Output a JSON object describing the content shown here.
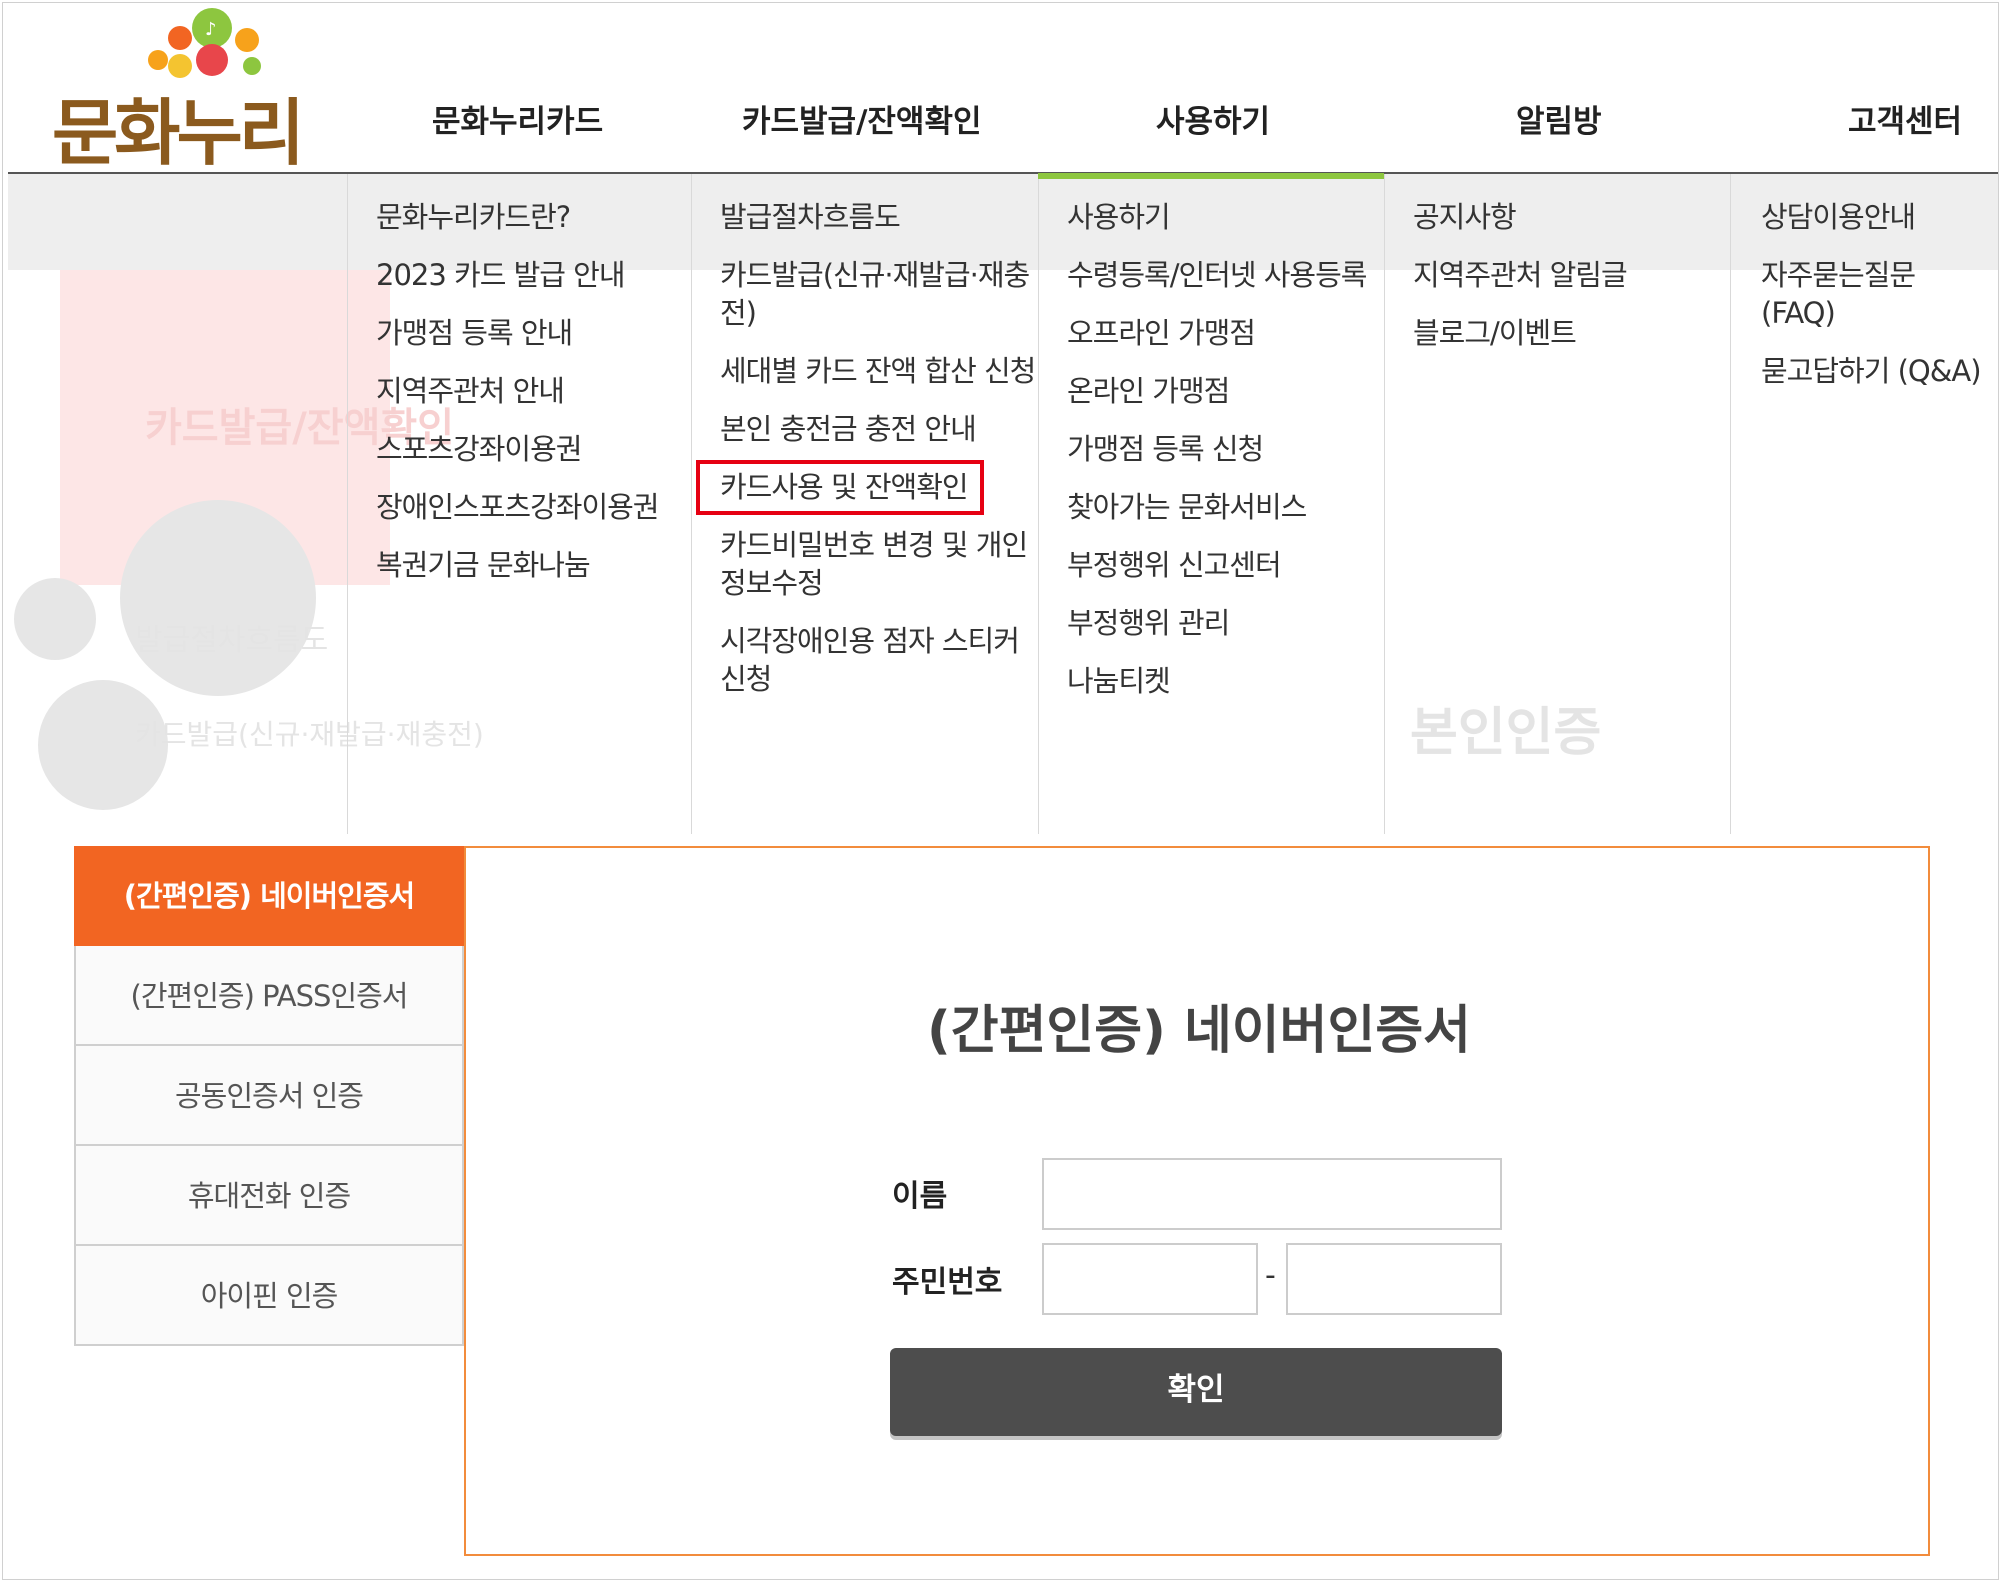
{
  "logo": {
    "text": "문화누리"
  },
  "nav": [
    "문화누리카드",
    "카드발급/잔액확인",
    "사용하기",
    "알림방",
    "고객센터"
  ],
  "menu": [
    [
      "문화누리카드란?",
      "2023 카드 발급 안내",
      "가맹점 등록 안내",
      "지역주관처 안내",
      "스포츠강좌이용권",
      "장애인스포츠강좌이용권",
      "복권기금 문화나눔"
    ],
    [
      "발급절차흐름도",
      "카드발급(신규·재발급·재충전)",
      "세대별 카드 잔액 합산 신청",
      "본인 충전금 충전 안내",
      "카드사용 및 잔액확인",
      "카드비밀번호 변경 및 개인정보수정",
      "시각장애인용 점자 스티커 신청"
    ],
    [
      "사용하기",
      "수령등록/인터넷 사용등록",
      "오프라인 가맹점",
      "온라인 가맹점",
      "가맹점 등록 신청",
      "찾아가는 문화서비스",
      "부정행위 신고센터",
      "부정행위 관리",
      "나눔티켓"
    ],
    [
      "공지사항",
      "지역주관처 알림글",
      "블로그/이벤트"
    ],
    [
      "상담이용안내",
      "자주묻는질문 (FAQ)",
      "묻고답하기 (Q&A)"
    ]
  ],
  "background_page": {
    "title": "카드발급/잔액확인",
    "sub1": "발급절차흐름도",
    "sub2": "카드발급(신규·재발급·재충전)",
    "heading": "본인인증"
  },
  "auth": {
    "tabs": [
      "(간편인증) 네이버인증서",
      "(간편인증) PASS인증서",
      "공동인증서 인증",
      "휴대전화 인증",
      "아이핀 인증"
    ],
    "active_tab": 0,
    "title": "(간편인증) 네이버인증서",
    "name_label": "이름",
    "rrn_label": "주민번호",
    "name_value": "",
    "rrn_front_value": "",
    "rrn_back_value": "",
    "separator": "-",
    "confirm_label": "확인"
  },
  "colors": {
    "accent_orange": "#f26522",
    "nav_active_green": "#8dc63f",
    "highlight_red": "#e60012",
    "button_dark": "#4d4d4d"
  }
}
